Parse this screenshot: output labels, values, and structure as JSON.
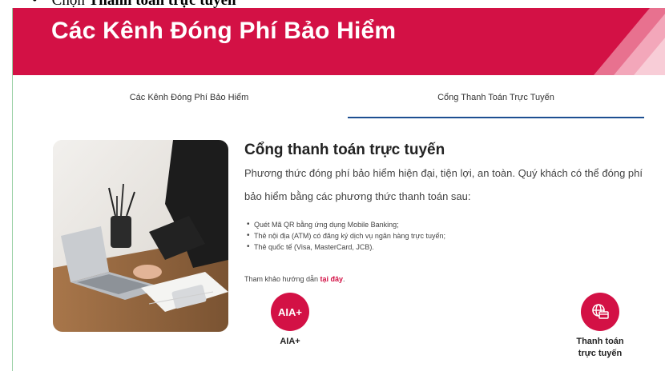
{
  "doc_line": {
    "bullet": "•",
    "prefix": "Chọn ",
    "bold": "Thanh toán trực tuyến"
  },
  "banner": {
    "title": "Các Kênh Đóng Phí Bảo Hiểm"
  },
  "tabs": [
    {
      "label": "Các Kênh Đóng Phí Bảo Hiểm",
      "active": false
    },
    {
      "label": "Cổng Thanh Toán Trực Tuyến",
      "active": true
    }
  ],
  "section": {
    "heading": "Cổng thanh toán trực tuyến",
    "description": "Phương thức đóng phí bảo hiểm hiện đại, tiện lợi, an toàn.  Quý khách có thể đóng phí bảo hiểm bằng các phương thức thanh toán sau:",
    "methods": [
      "Quét Mã QR bằng ứng dụng Mobile Banking;",
      "Thẻ nội địa (ATM) có đăng ký dịch vụ ngân hàng trực tuyến;",
      "Thẻ quốc tế (Visa, MasterCard, JCB)."
    ],
    "reference_text": "Tham khảo hướng dẫn ",
    "reference_link": "tại đây",
    "reference_end": "."
  },
  "channels": {
    "aia": {
      "icon_text": "AIA+",
      "label": "AIA+"
    },
    "online": {
      "icon": "globe-card-icon",
      "label_line1": "Thanh toán",
      "label_line2": "trực tuyến"
    }
  },
  "colors": {
    "brand_red": "#d31145",
    "tab_underline": "#1d4f91"
  }
}
